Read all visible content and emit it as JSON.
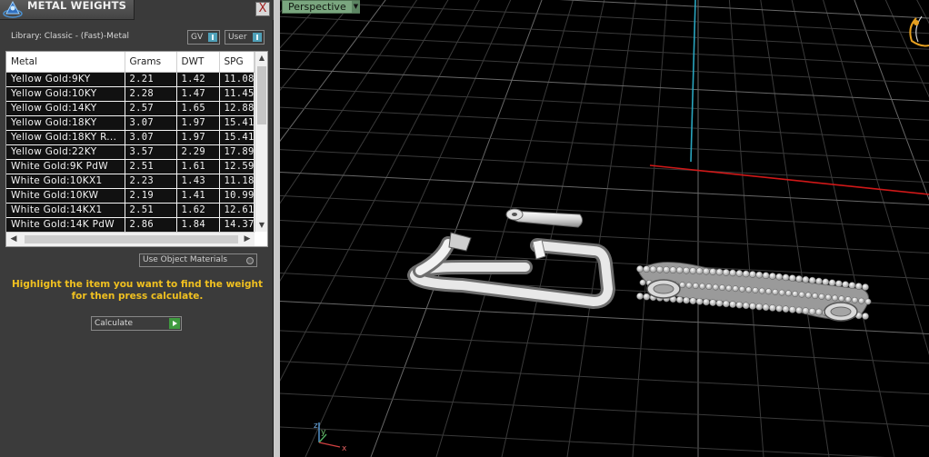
{
  "panel": {
    "title": "METAL WEIGHTS",
    "close": "X",
    "library_label": "Library: Classic - (Fast)-Metal",
    "toggles": [
      {
        "label": "GV"
      },
      {
        "label": "User"
      }
    ],
    "use_object_materials": "Use Object Materials",
    "instruction": "Highlight the item you want to find the weight for then press calculate.",
    "calculate_label": "Calculate"
  },
  "table": {
    "columns": [
      "Metal",
      "Grams",
      "DWT",
      "SPG"
    ],
    "rows": [
      [
        "Yellow Gold:9KY",
        "2.21",
        "1.42",
        "11.08"
      ],
      [
        "Yellow Gold:10KY",
        "2.28",
        "1.47",
        "11.45"
      ],
      [
        "Yellow Gold:14KY",
        "2.57",
        "1.65",
        "12.88"
      ],
      [
        "Yellow Gold:18KY",
        "3.07",
        "1.97",
        "15.41"
      ],
      [
        "Yellow Gold:18KY R...",
        "3.07",
        "1.97",
        "15.41"
      ],
      [
        "Yellow Gold:22KY",
        "3.57",
        "2.29",
        "17.89"
      ],
      [
        "White Gold:9K PdW",
        "2.51",
        "1.61",
        "12.59"
      ],
      [
        "White Gold:10KX1",
        "2.23",
        "1.43",
        "11.18"
      ],
      [
        "White Gold:10KW",
        "2.19",
        "1.41",
        "10.99"
      ],
      [
        "White Gold:14KX1",
        "2.51",
        "1.62",
        "12.61"
      ],
      [
        "White Gold:14K PdW",
        "2.86",
        "1.84",
        "14.37"
      ]
    ]
  },
  "viewport": {
    "label": "Perspective",
    "axes": {
      "z": "z",
      "y": "y",
      "x": "x"
    }
  },
  "colors": {
    "panel_bg": "#3b3b3b",
    "accent_yellow": "#f0c020",
    "viewport_label_bg": "#7aa67f",
    "axis_red": "#d01818",
    "axis_cyan": "#2aa6c0",
    "grid": "#5a5a5a"
  }
}
